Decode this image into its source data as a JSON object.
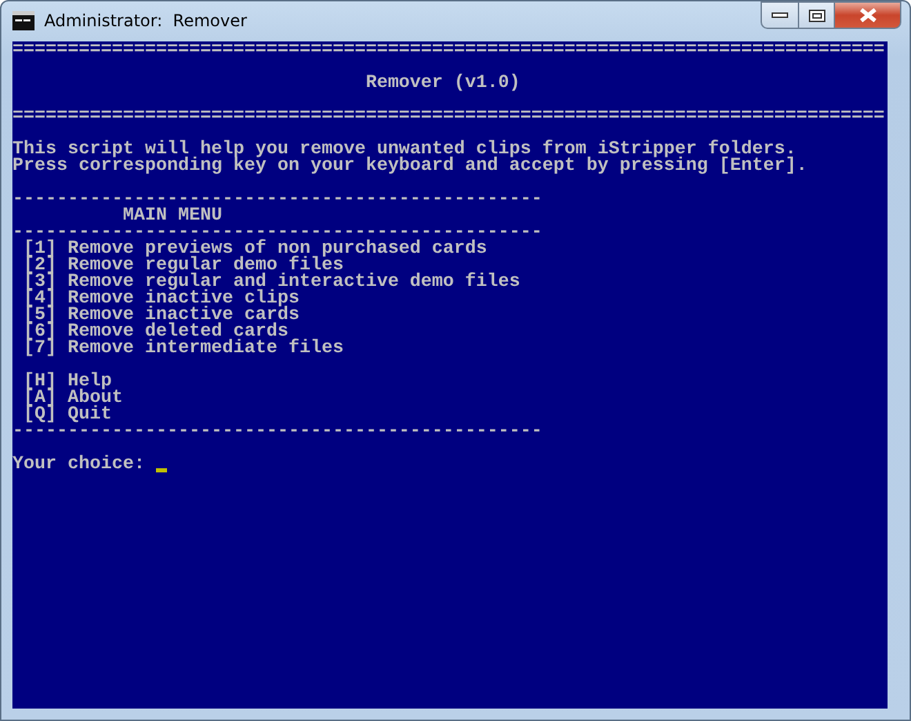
{
  "window": {
    "title": "Administrator:  Remover",
    "buttons": [
      {
        "kind": "minimize"
      },
      {
        "kind": "maximize"
      },
      {
        "kind": "close"
      }
    ]
  },
  "console": {
    "blocks": [
      [
        "==============================================================================="
      ],
      [
        "                                Remover (v1.0)"
      ],
      [
        "==============================================================================="
      ],
      [
        "This script will help you remove unwanted clips from iStripper folders.",
        "Press corresponding key on your keyboard and accept by pressing [Enter]."
      ],
      [
        "------------------------------------------------",
        "          MAIN MENU",
        "------------------------------------------------",
        " [1] Remove previews of non purchased cards",
        " [2] Remove regular demo files",
        " [3] Remove regular and interactive demo files",
        " [4] Remove inactive clips",
        " [5] Remove inactive cards",
        " [6] Remove deleted cards",
        " [7] Remove intermediate files"
      ],
      [
        " [H] Help",
        " [A] About",
        " [Q] Quit",
        "------------------------------------------------"
      ],
      [
        "Your choice: "
      ]
    ],
    "cursor_visible": true
  }
}
